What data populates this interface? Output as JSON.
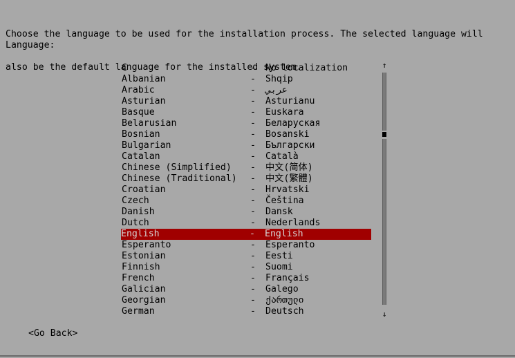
{
  "prompt": {
    "line1": "Choose the language to be used for the installation process. The selected language will",
    "line2": "also be the default language for the installed system."
  },
  "language_label": "Language:",
  "separator": "-",
  "languages": [
    {
      "name": "C",
      "native": "No localization"
    },
    {
      "name": "Albanian",
      "native": "Shqip"
    },
    {
      "name": "Arabic",
      "native": "عربي"
    },
    {
      "name": "Asturian",
      "native": "Asturianu"
    },
    {
      "name": "Basque",
      "native": "Euskara"
    },
    {
      "name": "Belarusian",
      "native": "Беларуская"
    },
    {
      "name": "Bosnian",
      "native": "Bosanski"
    },
    {
      "name": "Bulgarian",
      "native": "Български"
    },
    {
      "name": "Catalan",
      "native": "Català"
    },
    {
      "name": "Chinese (Simplified)",
      "native": "中文(简体)"
    },
    {
      "name": "Chinese (Traditional)",
      "native": "中文(繁體)"
    },
    {
      "name": "Croatian",
      "native": "Hrvatski"
    },
    {
      "name": "Czech",
      "native": "Čeština"
    },
    {
      "name": "Danish",
      "native": "Dansk"
    },
    {
      "name": "Dutch",
      "native": "Nederlands"
    },
    {
      "name": "English",
      "native": "English",
      "selected": true
    },
    {
      "name": "Esperanto",
      "native": "Esperanto"
    },
    {
      "name": "Estonian",
      "native": "Eesti"
    },
    {
      "name": "Finnish",
      "native": "Suomi"
    },
    {
      "name": "French",
      "native": "Français"
    },
    {
      "name": "Galician",
      "native": "Galego"
    },
    {
      "name": "Georgian",
      "native": "ქართული"
    },
    {
      "name": "German",
      "native": "Deutsch"
    }
  ],
  "scrollbar": {
    "up_arrow": "↑",
    "down_arrow": "↓",
    "position": 0.22
  },
  "go_back_label": "<Go Back>",
  "colors": {
    "background": "#a8a8a8",
    "selection": "#a00000",
    "selection_text": "#d8d8d8"
  }
}
